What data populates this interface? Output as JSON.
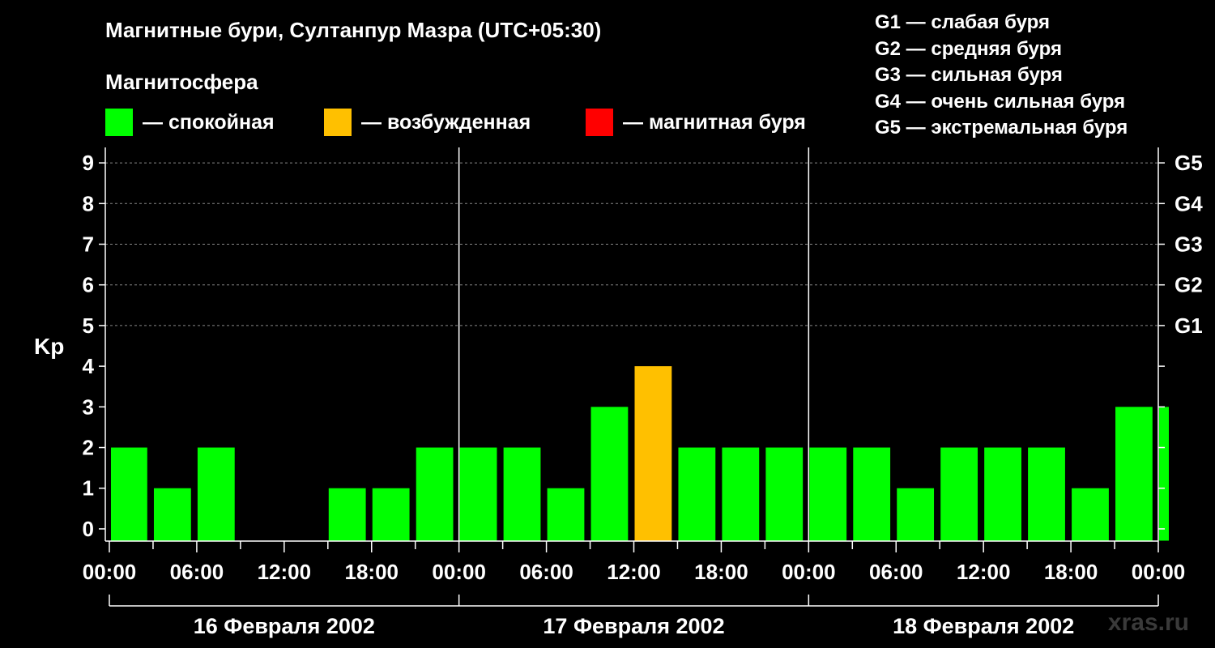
{
  "page": {
    "title": "Магнитные бури, Султанпур Мазра (UTC+05:30)",
    "watermark": "xras.ru"
  },
  "legend": {
    "heading": "Магнитосфера",
    "items": [
      {
        "label": "— спокойная",
        "color": "#00ff00"
      },
      {
        "label": "— возбужденная",
        "color": "#ffc000"
      },
      {
        "label": "— магнитная буря",
        "color": "#ff0000"
      }
    ]
  },
  "storm_levels": [
    "G1 — слабая буря",
    "G2 — средняя буря",
    "G3 — сильная буря",
    "G4 — очень сильная буря",
    "G5 — экстремальная буря"
  ],
  "chart_data": {
    "type": "bar",
    "ylabel": "Kp",
    "ylim": [
      0,
      9
    ],
    "y_ticks": [
      0,
      1,
      2,
      3,
      4,
      5,
      6,
      7,
      8,
      9
    ],
    "right_axis_labels": [
      {
        "y": 5,
        "label": "G1"
      },
      {
        "y": 6,
        "label": "G2"
      },
      {
        "y": 7,
        "label": "G3"
      },
      {
        "y": 8,
        "label": "G4"
      },
      {
        "y": 9,
        "label": "G5"
      }
    ],
    "x_tick_labels": [
      "00:00",
      "06:00",
      "12:00",
      "18:00",
      "00:00",
      "06:00",
      "12:00",
      "18:00",
      "00:00",
      "06:00",
      "12:00",
      "18:00",
      "00:00"
    ],
    "days": [
      "16 Февраля 2002",
      "17 Февраля 2002",
      "18 Февраля 2002"
    ],
    "grid": "horizontal dashed",
    "interval_hours": 3,
    "values": [
      2,
      1,
      2,
      0,
      0,
      1,
      1,
      2,
      2,
      2,
      1,
      3,
      4,
      2,
      2,
      2,
      2,
      2,
      1,
      2,
      2,
      2,
      1,
      3,
      3
    ],
    "colors": [
      "#00ff00",
      "#00ff00",
      "#00ff00",
      "#00ff00",
      "#00ff00",
      "#00ff00",
      "#00ff00",
      "#00ff00",
      "#00ff00",
      "#00ff00",
      "#00ff00",
      "#00ff00",
      "#ffc000",
      "#00ff00",
      "#00ff00",
      "#00ff00",
      "#00ff00",
      "#00ff00",
      "#00ff00",
      "#00ff00",
      "#00ff00",
      "#00ff00",
      "#00ff00",
      "#00ff00",
      "#00ff00"
    ]
  }
}
